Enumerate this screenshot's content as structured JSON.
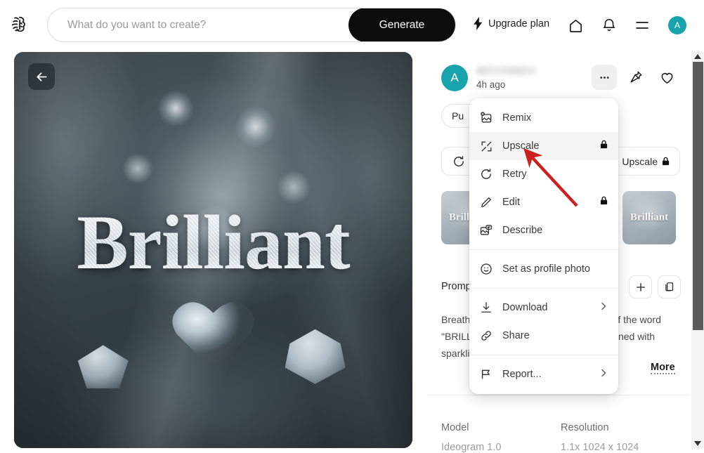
{
  "header": {
    "logo_icon": "brain-logo-icon",
    "search": {
      "value": "",
      "placeholder": "What do you want to create?"
    },
    "generate_label": "Generate",
    "upgrade_label": "Upgrade plan",
    "upgrade_icon": "lightning-bolt-icon",
    "icons": [
      "home-icon",
      "bell-icon",
      "hamburger-menu-icon"
    ],
    "avatar_initial": "A",
    "avatar_color": "#17a2ac"
  },
  "image_panel": {
    "back_icon": "arrow-left-icon",
    "artwork_word": "Brilliant"
  },
  "detail": {
    "avatar_initial": "A",
    "username": "",
    "time_ago": "4h ago",
    "actions": {
      "more_icon": "ellipsis-icon",
      "pin_icon": "pin-icon",
      "favorite_icon": "heart-icon"
    },
    "visibility_label": "Pu",
    "action_bar": {
      "retry_icon": "retry-icon",
      "upscale_label": "Upscale",
      "upscale_lock_icon": "lock-icon"
    },
    "thumbnails": [
      {
        "label": "Brilliant"
      },
      {
        "label": "Brilliant"
      },
      {
        "label": "Brilliant"
      },
      {
        "label": "Brilliant"
      }
    ],
    "prompt_header": "Prompt",
    "prompt_add_icon": "plus-icon",
    "prompt_copy_icon": "copy-icon",
    "prompt_text": "Breathtaking elegant 3D text rendering of the word \"BRILLIANT\" in an ornate serif font, adorned with sparkling diamonds and flowers",
    "more_label": "More",
    "info": [
      {
        "key": "Model",
        "value": "Ideogram 1.0"
      },
      {
        "key": "Resolution",
        "value": "1.1x 1024 x 1024"
      }
    ]
  },
  "context_menu": {
    "items": [
      {
        "label": "Remix",
        "icon": "remix-image-icon",
        "lock": false,
        "chevron": false,
        "active": false,
        "sep_after": false
      },
      {
        "label": "Upscale",
        "icon": "upscale-icon",
        "lock": true,
        "chevron": false,
        "active": true,
        "sep_after": false
      },
      {
        "label": "Retry",
        "icon": "retry-icon",
        "lock": false,
        "chevron": false,
        "active": false,
        "sep_after": false
      },
      {
        "label": "Edit",
        "icon": "pencil-icon",
        "lock": true,
        "chevron": false,
        "active": false,
        "sep_after": false
      },
      {
        "label": "Describe",
        "icon": "describe-image-icon",
        "lock": false,
        "chevron": false,
        "active": false,
        "sep_after": true
      },
      {
        "label": "Set as profile photo",
        "icon": "smiley-icon",
        "lock": false,
        "chevron": false,
        "active": false,
        "sep_after": true
      },
      {
        "label": "Download",
        "icon": "download-icon",
        "lock": false,
        "chevron": true,
        "active": false,
        "sep_after": false
      },
      {
        "label": "Share",
        "icon": "link-icon",
        "lock": false,
        "chevron": false,
        "active": false,
        "sep_after": true
      },
      {
        "label": "Report...",
        "icon": "flag-icon",
        "lock": false,
        "chevron": true,
        "active": false,
        "sep_after": false
      }
    ]
  },
  "scrollbar": {
    "up_icon": "scroll-up-arrow-icon",
    "down_icon": "scroll-down-arrow-icon"
  },
  "annotation": {
    "arrow_color": "#cc1f1f",
    "points_to": "Upscale"
  }
}
